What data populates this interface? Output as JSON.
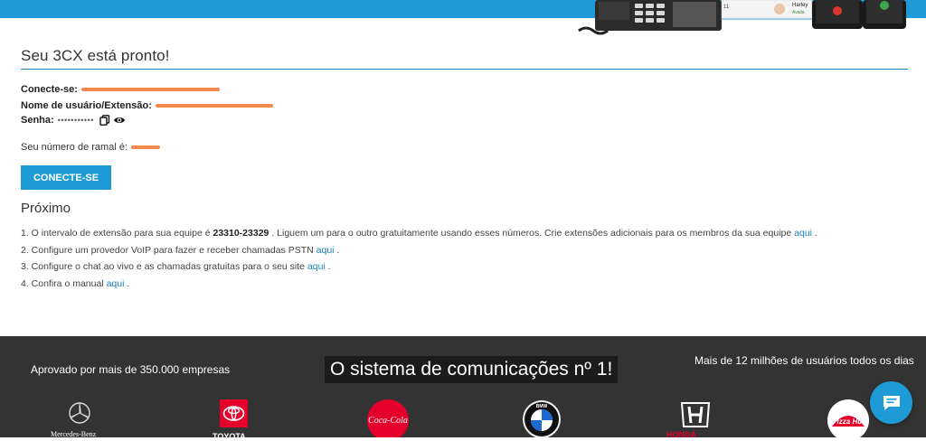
{
  "hero": {
    "contact_name": "Harley",
    "contact_status": "Availa",
    "phone_snippet": "11"
  },
  "main": {
    "title": "Seu 3CX está pronto!",
    "connect_label": "Conecte-se:",
    "username_label": "Nome de usuário/Extensão:",
    "password_label": "Senha:",
    "password_mask": "•••••••••••",
    "extension_number_label": "Seu número de ramal é:",
    "connect_button": "CONECTE-SE"
  },
  "next": {
    "heading": "Próximo",
    "step1_prefix": "1. O intervalo de extensão para sua equipe é ",
    "step1_range": "23310-23329",
    "step1_suffix": " . Liguem um para o outro gratuitamente usando esses números. Crie extensões adicionais para os membros da sua equipe ",
    "step2_prefix": "2. Configure um provedor VoIP para fazer e receber chamadas PSTN ",
    "step3_prefix": "3. Configure o chat ao vivo e as chamadas gratuitas para o seu site ",
    "step4_prefix": "4. Confira o manual ",
    "link_text": "aqui",
    "period": " ."
  },
  "footer": {
    "approved": "Aprovado por mais de 350.000 empresas",
    "slogan": "O sistema de comunicações nº 1!",
    "users": "Mais de 12 milhões de usuários todos os dias",
    "logos": {
      "mercedes": "Mercedes-Benz",
      "toyota": "TOYOTA",
      "honda": "HONDA",
      "pizza": "Pizza Hut",
      "coca": "Coca-Cola",
      "bmw": "BMW"
    }
  },
  "icons": [
    "copy-icon",
    "eye-icon",
    "chat-icon"
  ],
  "colors": {
    "accent": "#1e9bd7",
    "footer_bg": "#333333",
    "link": "#1e7fc0",
    "redaction": "#f47b3c"
  }
}
